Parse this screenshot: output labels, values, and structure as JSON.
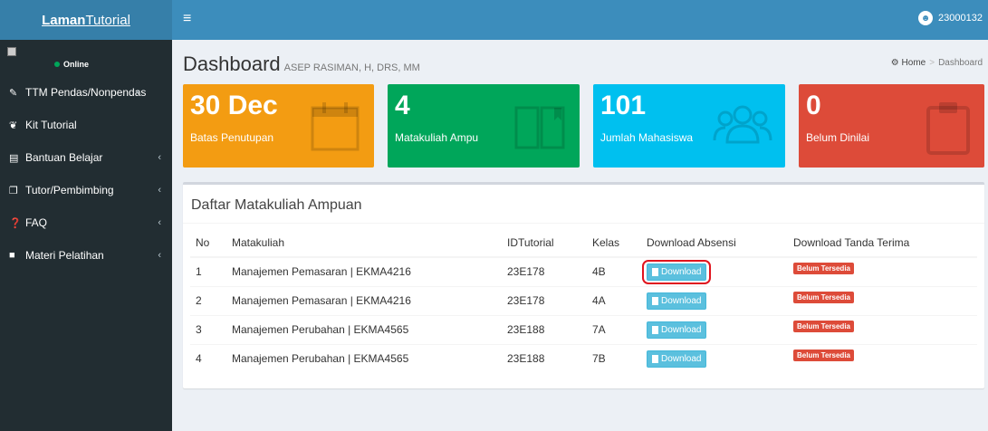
{
  "logo": {
    "bold": "Laman",
    "light": "Tutorial"
  },
  "topbar": {
    "menu_icon": "bars-icon",
    "user_id": "23000132"
  },
  "sidebar": {
    "status": "Online",
    "items": [
      {
        "label": "TTM Pendas/Nonpendas",
        "icon": "edit-icon"
      },
      {
        "label": "Kit Tutorial",
        "icon": "leaf-icon"
      },
      {
        "label": "Bantuan Belajar",
        "icon": "book-icon"
      },
      {
        "label": "Tutor/Pembimbing",
        "icon": "clone-icon"
      },
      {
        "label": "FAQ",
        "icon": "question-circle-icon"
      },
      {
        "label": "Materi Pelatihan",
        "icon": "folder-icon"
      }
    ]
  },
  "header": {
    "title": "Dashboard",
    "subtitle": "ASEP RASIMAN, H, DRS, MM"
  },
  "breadcrumb": {
    "home": "Home",
    "current": "Dashboard"
  },
  "stats": [
    {
      "value": "30 Dec",
      "label": "Batas Penutupan",
      "color": "#f39c12",
      "icon": "calendar-icon"
    },
    {
      "value": "4",
      "label": "Matakuliah Ampu",
      "color": "#00a65a",
      "icon": "book-open-icon"
    },
    {
      "value": "101",
      "label": "Jumlah Mahasiswa",
      "color": "#00c0ef",
      "icon": "users-icon"
    },
    {
      "value": "0",
      "label": "Belum Dinilai",
      "color": "#dd4b39",
      "icon": "clipboard-icon"
    }
  ],
  "table": {
    "title": "Daftar Matakuliah Ampuan",
    "headers": [
      "No",
      "Matakuliah",
      "IDTutorial",
      "Kelas",
      "Download Absensi",
      "Download Tanda Terima"
    ],
    "download_label": "Download",
    "badge_label": "Belum Tersedia",
    "rows": [
      {
        "no": "1",
        "matakuliah": "Manajemen Pemasaran | EKMA4216",
        "id": "23E178",
        "kelas": "4B"
      },
      {
        "no": "2",
        "matakuliah": "Manajemen Pemasaran | EKMA4216",
        "id": "23E178",
        "kelas": "4A"
      },
      {
        "no": "3",
        "matakuliah": "Manajemen Perubahan | EKMA4565",
        "id": "23E188",
        "kelas": "7A"
      },
      {
        "no": "4",
        "matakuliah": "Manajemen Perubahan | EKMA4565",
        "id": "23E188",
        "kelas": "7B"
      }
    ]
  }
}
